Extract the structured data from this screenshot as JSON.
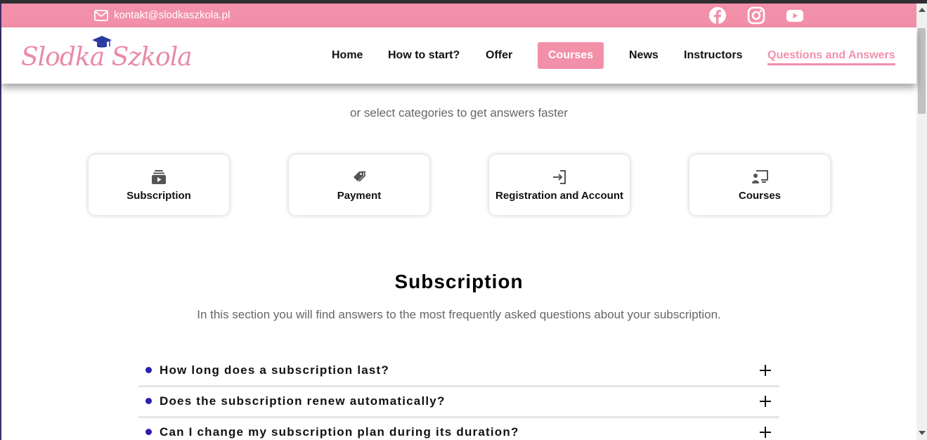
{
  "topbar": {
    "email": "kontakt@slodkaszkola.pl",
    "social": [
      "facebook-icon",
      "instagram-icon",
      "youtube-icon"
    ],
    "bg_color": "#f290aa"
  },
  "header": {
    "logo_text": "Slodka Szkola",
    "nav": [
      {
        "label": "Home"
      },
      {
        "label": "How to start?"
      },
      {
        "label": "Offer"
      },
      {
        "label": "Courses",
        "state": "highlighted"
      },
      {
        "label": "News"
      },
      {
        "label": "Instructors"
      },
      {
        "label": "Questions and Answers",
        "state": "current"
      }
    ],
    "accent_color": "#f290aa"
  },
  "main": {
    "subtitle": "or select categories to get answers faster",
    "categories": [
      {
        "label": "Subscription",
        "icon": "subscription-icon"
      },
      {
        "label": "Payment",
        "icon": "tag-icon"
      },
      {
        "label": "Registration and Account",
        "icon": "sign-in-icon"
      },
      {
        "label": "Courses",
        "icon": "presentation-icon"
      }
    ],
    "section": {
      "title": "Subscription",
      "description": "In this section you will find answers to the most frequently asked questions about your subscription.",
      "faqs": [
        {
          "question": "How long does a subscription last?"
        },
        {
          "question": "Does the subscription renew automatically?"
        },
        {
          "question": "Can I change my subscription plan during its duration?"
        }
      ]
    },
    "bullet_color": "#2a1fb0"
  }
}
